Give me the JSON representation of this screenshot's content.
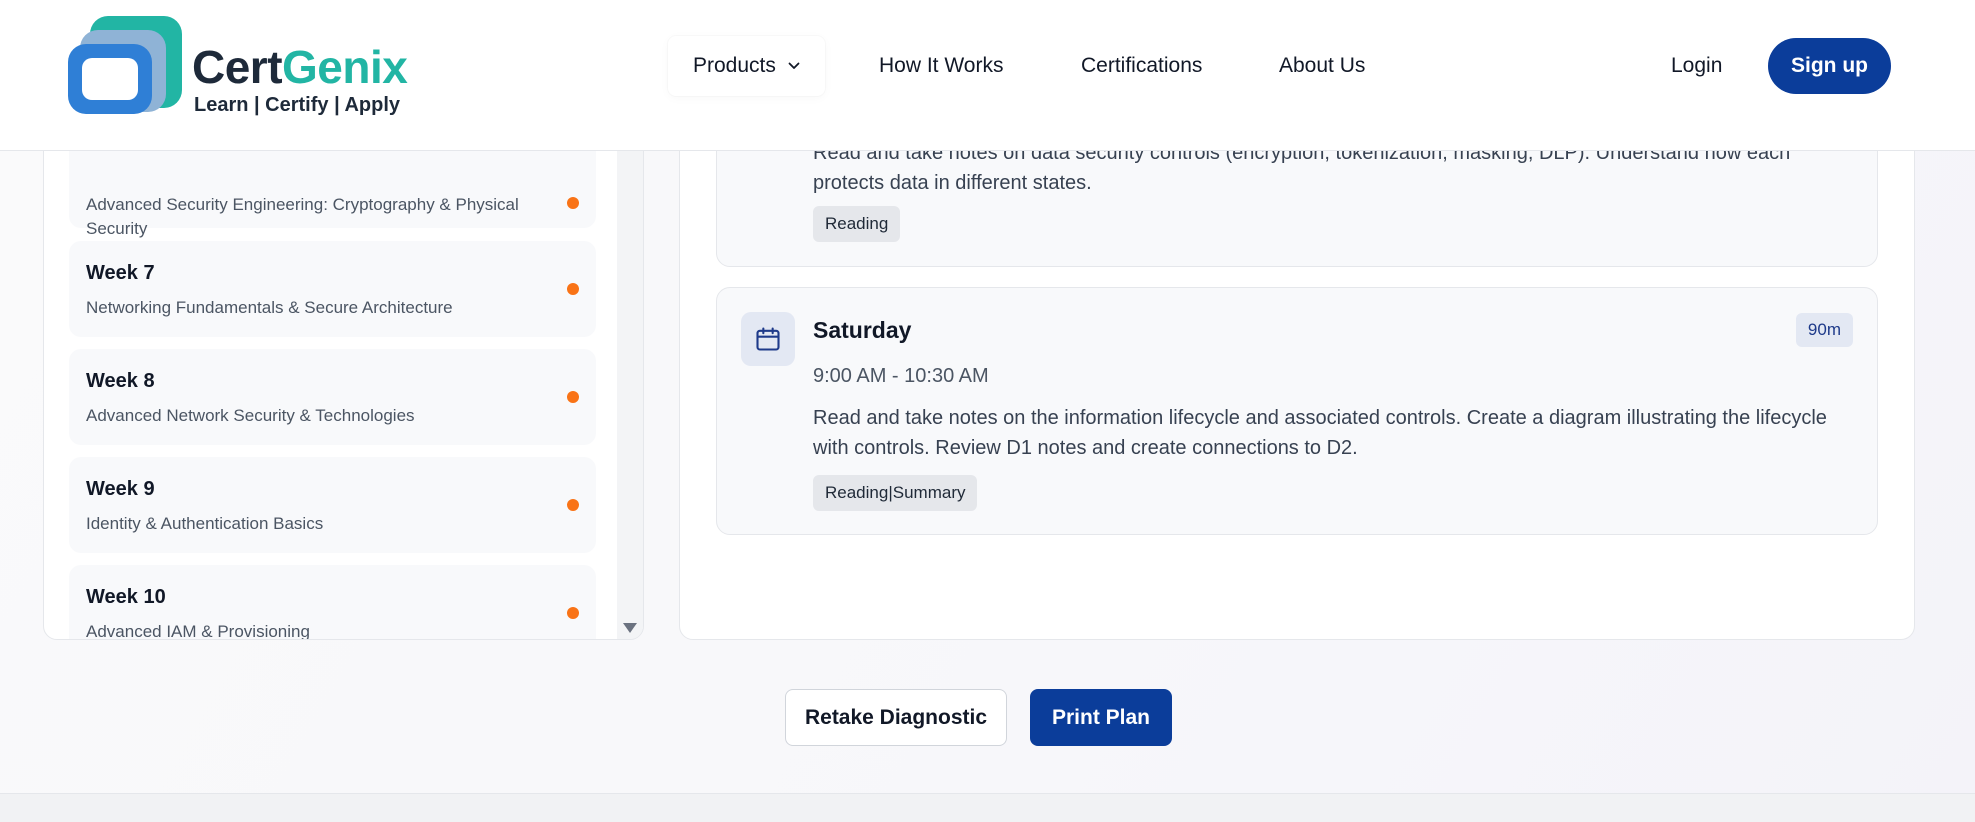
{
  "header": {
    "brand_part1": "Cert",
    "brand_part2": "Genix",
    "tagline": "Learn | Certify | Apply",
    "nav": {
      "products": "Products",
      "how_it_works": "How It Works",
      "certifications": "Certifications",
      "about_us": "About Us"
    },
    "login": "Login",
    "signup": "Sign up"
  },
  "weeks": [
    {
      "title": "",
      "subtitle": "Advanced Security Engineering: Cryptography & Physical Security"
    },
    {
      "title": "Week 7",
      "subtitle": "Networking Fundamentals & Secure Architecture"
    },
    {
      "title": "Week 8",
      "subtitle": "Advanced Network Security & Technologies"
    },
    {
      "title": "Week 9",
      "subtitle": "Identity & Authentication Basics"
    },
    {
      "title": "Week 10",
      "subtitle": "Advanced IAM & Provisioning"
    }
  ],
  "days": [
    {
      "description": "Read and take notes on data security controls (encryption, tokenization, masking, DLP). Understand how each protects data in different states.",
      "tag": "Reading"
    },
    {
      "day": "Saturday",
      "time": "9:00 AM - 10:30 AM",
      "duration": "90m",
      "description": "Read and take notes on the information lifecycle and associated controls. Create a diagram illustrating the lifecycle with controls. Review D1 notes and create connections to D2.",
      "tag": "Reading|Summary"
    }
  ],
  "actions": {
    "retake": "Retake Diagnostic",
    "print": "Print Plan"
  },
  "colors": {
    "primary": "#0b3d9a",
    "teal": "#22b5a4",
    "status_dot": "#f97316"
  }
}
